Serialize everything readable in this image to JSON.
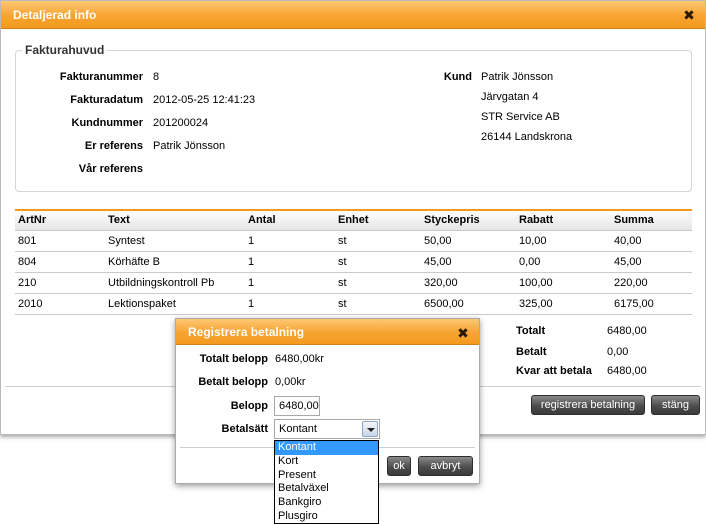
{
  "window": {
    "title": "Detaljerad info"
  },
  "header_section": {
    "legend": "Fakturahuvud",
    "fields": [
      {
        "label": "Fakturanummer",
        "value": "8"
      },
      {
        "label": "Fakturadatum",
        "value": "2012-05-25 12:41:23"
      },
      {
        "label": "Kundnummer",
        "value": "201200024"
      },
      {
        "label": "Er referens",
        "value": "Patrik Jönsson"
      },
      {
        "label": "Vår referens",
        "value": ""
      }
    ],
    "customer_label": "Kund",
    "customer_lines": [
      "Patrik Jönsson",
      "Järvgatan 4",
      "STR Service AB",
      "26144 Landskrona"
    ]
  },
  "lines_table": {
    "columns": [
      "ArtNr",
      "Text",
      "Antal",
      "Enhet",
      "Styckepris",
      "Rabatt",
      "Summa"
    ],
    "rows": [
      [
        "801",
        "Syntest",
        "1",
        "st",
        "50,00",
        "10,00",
        "40,00"
      ],
      [
        "804",
        "Körhäfte B",
        "1",
        "st",
        "45,00",
        "0,00",
        "45,00"
      ],
      [
        "210",
        "Utbildningskontroll Pb",
        "1",
        "st",
        "320,00",
        "100,00",
        "220,00"
      ],
      [
        "2010",
        "Lektionspaket",
        "1",
        "st",
        "6500,00",
        "325,00",
        "6175,00"
      ]
    ]
  },
  "totals": [
    {
      "label": "Totalt",
      "value": "6480,00"
    },
    {
      "label": "Betalt",
      "value": "0,00"
    },
    {
      "label": "Kvar att betala",
      "value": "6480,00"
    }
  ],
  "buttons": {
    "register_payment": "registrera betalning",
    "close": "stäng"
  },
  "payment_dialog": {
    "title": "Registrera betalning",
    "total_label": "Totalt belopp",
    "total_value": "6480,00kr",
    "paid_label": "Betalt belopp",
    "paid_value": "0,00kr",
    "amount_label": "Belopp",
    "amount_value": "6480,00",
    "method_label": "Betalsätt",
    "method_selected": "Kontant",
    "method_options": [
      "Kontant",
      "Kort",
      "Present",
      "Betalväxel",
      "Bankgiro",
      "Plusgiro"
    ],
    "ok_label": "ok",
    "cancel_label": "avbryt"
  },
  "colors": {
    "accent": "#f7a431",
    "selection": "#3399ff"
  }
}
